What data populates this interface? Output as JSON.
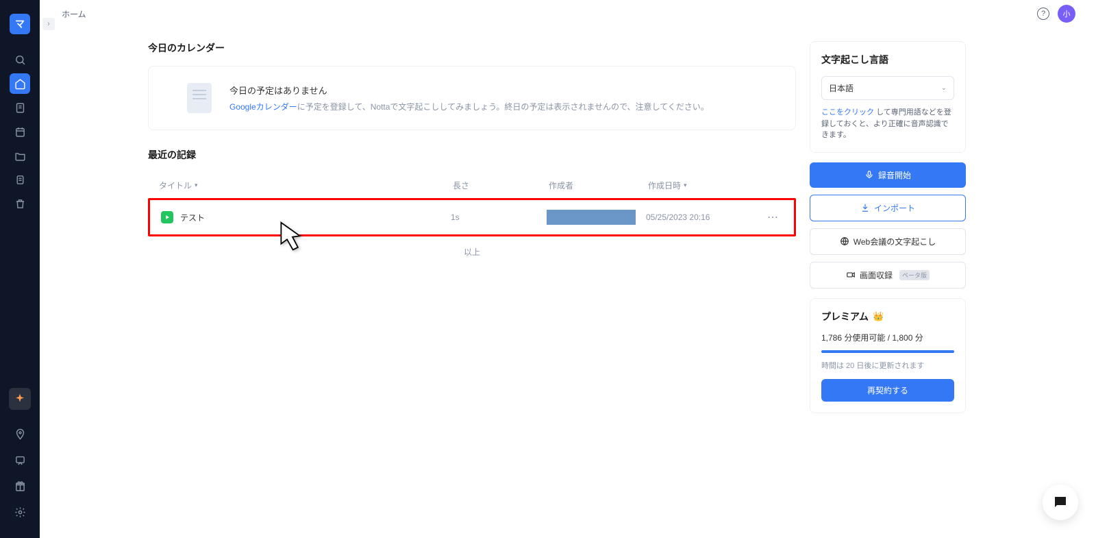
{
  "sidebar": {
    "logo": "マ"
  },
  "header": {
    "breadcrumb": "ホーム",
    "avatar": "小"
  },
  "calendar": {
    "section_title": "今日のカレンダー",
    "empty_title": "今日の予定はありません",
    "link": "Googleカレンダー",
    "desc_rest": "に予定を登録して、Nottaで文字起こししてみましょう。終日の予定は表示されませんので、注意してください。"
  },
  "records": {
    "section_title": "最近の記録",
    "columns": {
      "title": "タイトル",
      "length": "長さ",
      "creator": "作成者",
      "date": "作成日時"
    },
    "rows": [
      {
        "title": "テスト",
        "length": "1s",
        "date": "05/25/2023 20:16"
      }
    ],
    "end": "以上"
  },
  "right": {
    "lang_title": "文字起こし言語",
    "lang_value": "日本語",
    "lang_hint_link": "ここをクリック",
    "lang_hint_rest": "して専門用語などを登録しておくと、より正確に音声認識できます。",
    "record_btn": "録音開始",
    "import_btn": "インポート",
    "web_btn": "Web会議の文字起こし",
    "screen_btn": "画面収録",
    "beta": "ベータ版",
    "premium_title": "プレミアム",
    "usage": "1,786 分使用可能 / 1,800 分",
    "renew_info": "時間は 20 日後に更新されます",
    "renew_btn": "再契約する"
  }
}
